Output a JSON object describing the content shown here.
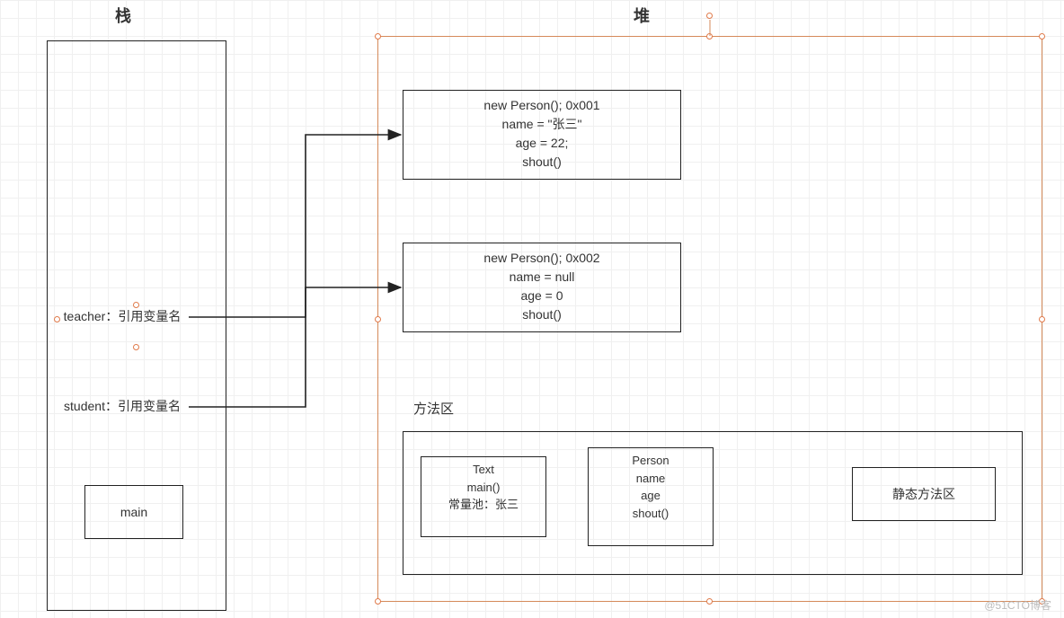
{
  "titles": {
    "stack": "栈",
    "heap": "堆"
  },
  "stack": {
    "teacher": "teacher：引用变量名",
    "student": "student：引用变量名",
    "main": "main"
  },
  "heap": {
    "obj1": {
      "line1": "new  Person();  0x001",
      "line2": "name = \"张三\"",
      "line3": "age = 22;",
      "line4": "shout()"
    },
    "obj2": {
      "line1": "new  Person();  0x002",
      "line2": "name = null",
      "line3": "age = 0",
      "line4": "shout()"
    },
    "method_area_title": "方法区",
    "method_area": {
      "text_box": {
        "l1": "Text",
        "l2": "main()",
        "l3": "常量池：张三"
      },
      "person_box": {
        "l1": "Person",
        "l2": "name",
        "l3": "age",
        "l4": "shout()"
      },
      "static_box": "静态方法区"
    }
  },
  "watermark": "@51CTO博客"
}
